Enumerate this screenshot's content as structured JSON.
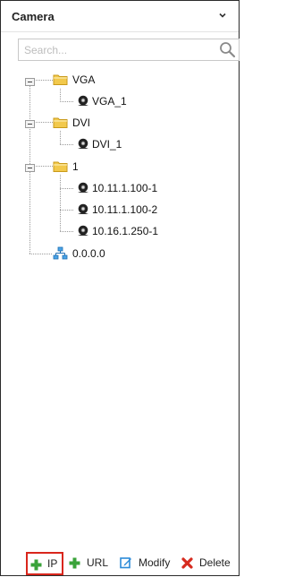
{
  "panel": {
    "title": "Camera",
    "collapse_icon": "chevron-down-icon"
  },
  "search": {
    "placeholder": "Search...",
    "value": "",
    "icon": "search-icon"
  },
  "tree": {
    "nodes": [
      {
        "label": "VGA",
        "type": "folder",
        "expanded": true,
        "children": [
          {
            "label": "VGA_1",
            "type": "camera"
          }
        ]
      },
      {
        "label": "DVI",
        "type": "folder",
        "expanded": true,
        "children": [
          {
            "label": "DVI_1",
            "type": "camera"
          }
        ]
      },
      {
        "label": "1",
        "type": "folder",
        "expanded": true,
        "children": [
          {
            "label": "10.11.1.100-1",
            "type": "camera"
          },
          {
            "label": "10.11.1.100-2",
            "type": "camera"
          },
          {
            "label": "10.16.1.250-1",
            "type": "camera"
          }
        ]
      },
      {
        "label": "0.0.0.0",
        "type": "network"
      }
    ]
  },
  "toolbar": {
    "ip_label": "IP",
    "url_label": "URL",
    "modify_label": "Modify",
    "delete_label": "Delete",
    "highlight_color": "#d9261c",
    "add_color": "#3aa33a",
    "modify_color": "#2b8ad8",
    "delete_color": "#d62b1f"
  }
}
